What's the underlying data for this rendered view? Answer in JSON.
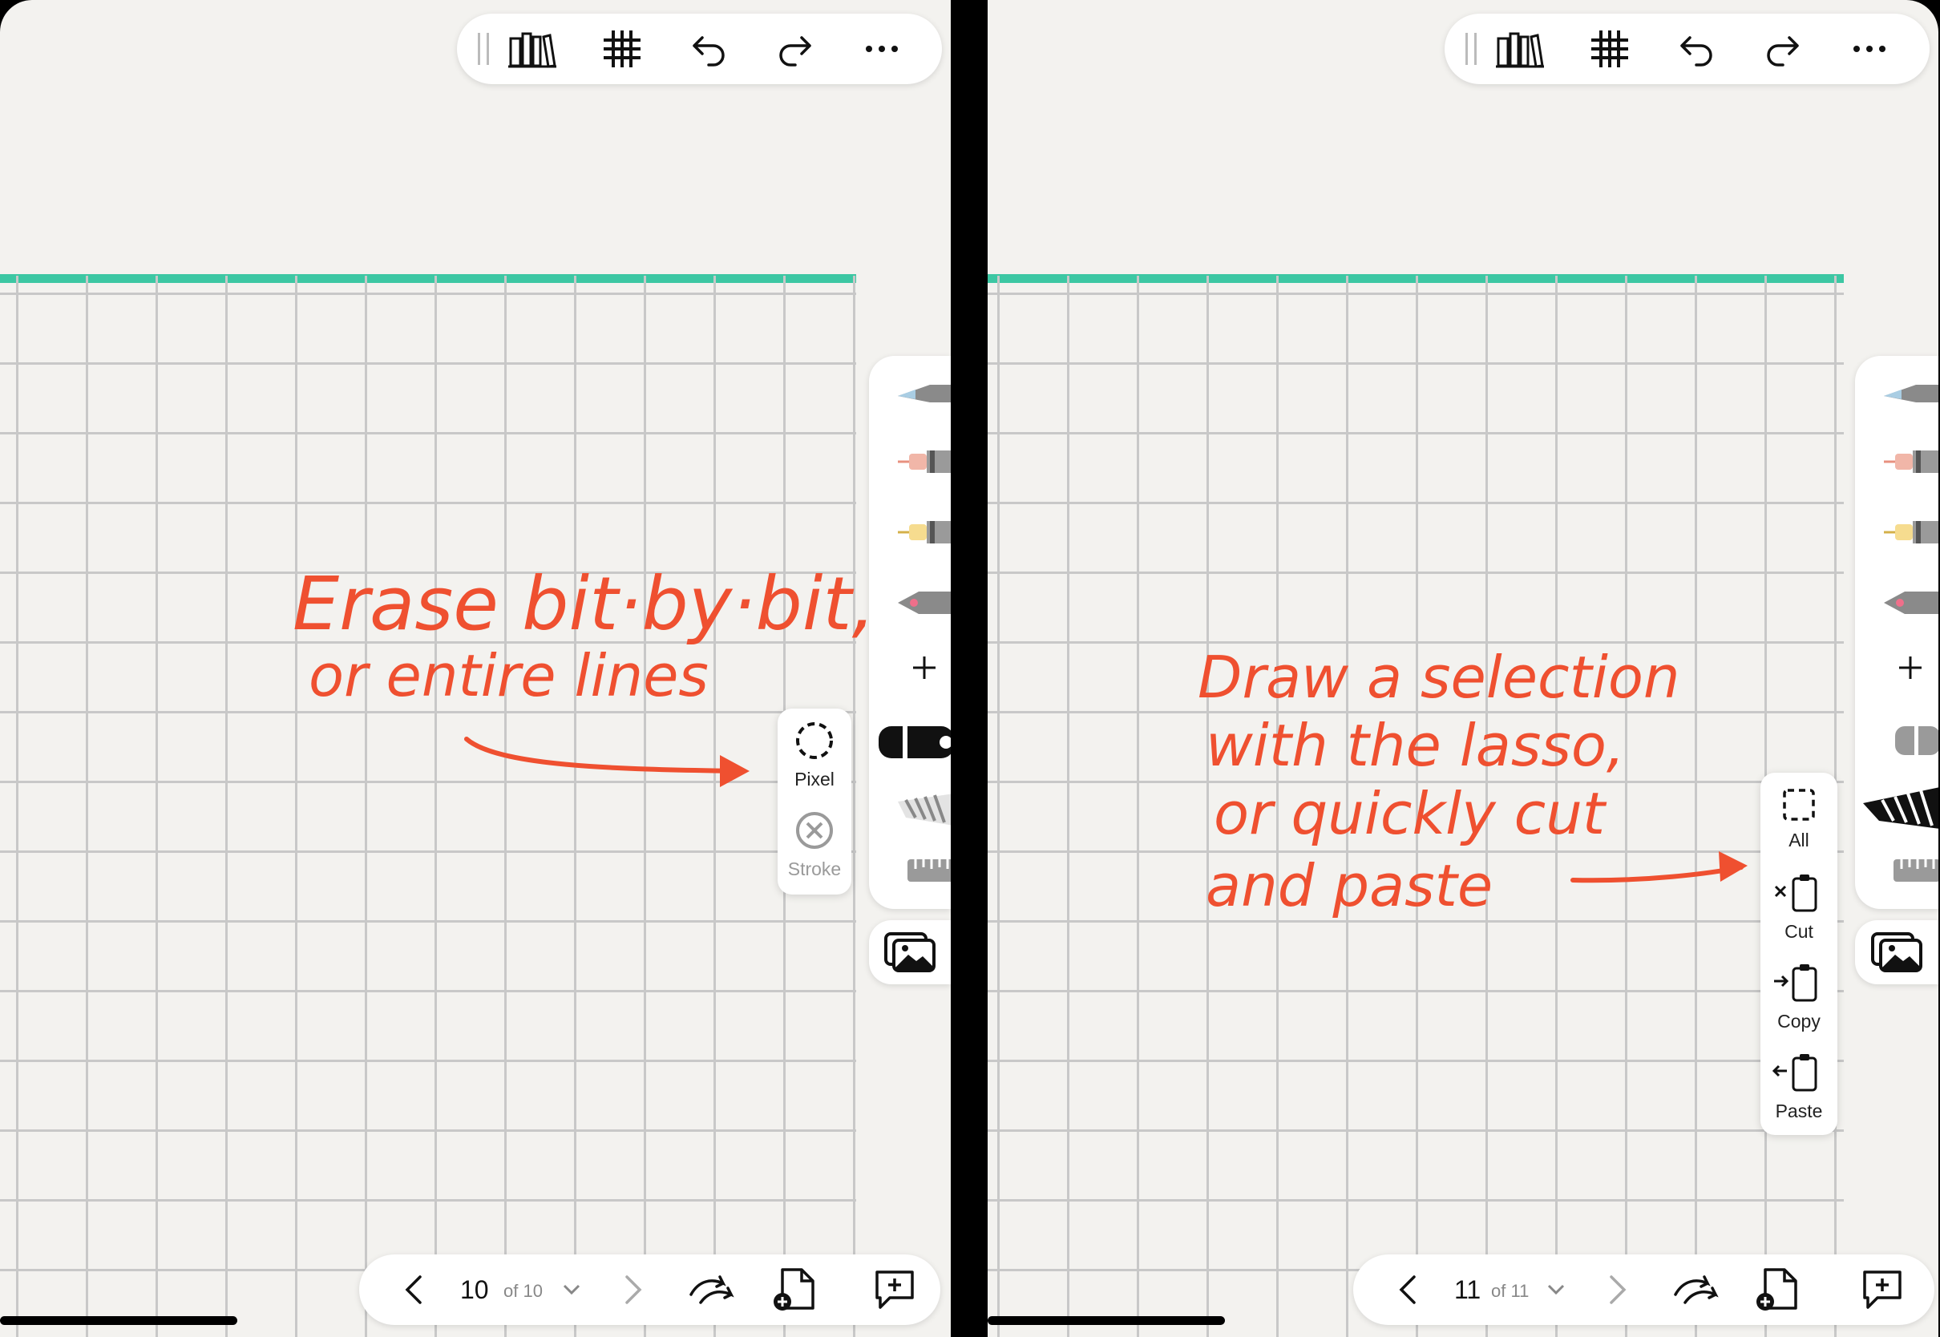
{
  "colors": {
    "accent_line": "#3cc7a3",
    "ink": "#ef5030",
    "paper": "#f3f2ef",
    "grid": "#c8c8c8"
  },
  "toolbar_icons": [
    "library-icon",
    "grid-icon",
    "undo-icon",
    "redo-icon",
    "more-icon"
  ],
  "left": {
    "note": {
      "line1": "Erase  bit·by·bit,",
      "line2": "or  entire lines"
    },
    "eraser_menu": {
      "items": [
        {
          "label": "Pixel",
          "icon": "dashed-circle-icon",
          "active": true
        },
        {
          "label": "Stroke",
          "icon": "circle-x-icon",
          "active": false
        }
      ]
    },
    "pager": {
      "current": "10",
      "total": "of 10"
    }
  },
  "right": {
    "note": {
      "line1": "Draw  a  selection",
      "line2": "with the lasso,",
      "line3": "or quickly cut",
      "line4": "and paste"
    },
    "lasso_menu": {
      "items": [
        {
          "label": "All",
          "icon": "dashed-square-icon"
        },
        {
          "label": "Cut",
          "icon": "cut-clipboard-icon"
        },
        {
          "label": "Copy",
          "icon": "copy-clipboard-icon"
        },
        {
          "label": "Paste",
          "icon": "paste-clipboard-icon"
        }
      ]
    },
    "pager": {
      "current": "11",
      "total": "of 11"
    }
  }
}
